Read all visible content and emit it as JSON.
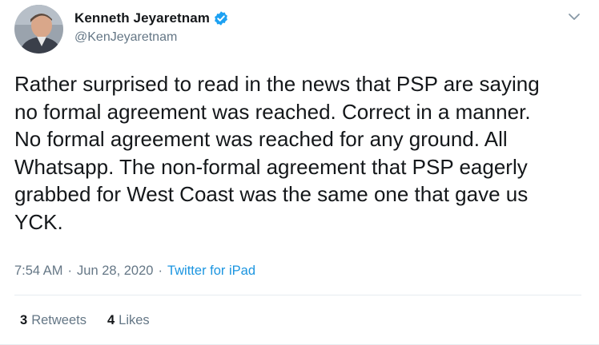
{
  "tweet": {
    "author": {
      "display_name": "Kenneth Jeyaretnam",
      "handle": "@KenJeyaretnam",
      "verified": true,
      "avatar_icon": "profile-photo"
    },
    "text": "Rather surprised to read in the news that PSP are saying\nno formal agreement was reached. Correct in a manner.\nNo formal agreement was reached for any ground. All\nWhatsapp. The non-formal agreement that PSP eagerly\ngrabbed for West Coast was the same one that gave us\nYCK.",
    "time": "7:54 AM",
    "separator": "·",
    "date": "Jun 28, 2020",
    "source": "Twitter for iPad",
    "stats": {
      "retweets_count": "3",
      "retweets_label": "Retweets",
      "likes_count": "4",
      "likes_label": "Likes"
    },
    "colors": {
      "verified_blue": "#1da1f2",
      "link_blue": "#1b95e0",
      "secondary_text": "#657786",
      "primary_text": "#14171a"
    }
  }
}
